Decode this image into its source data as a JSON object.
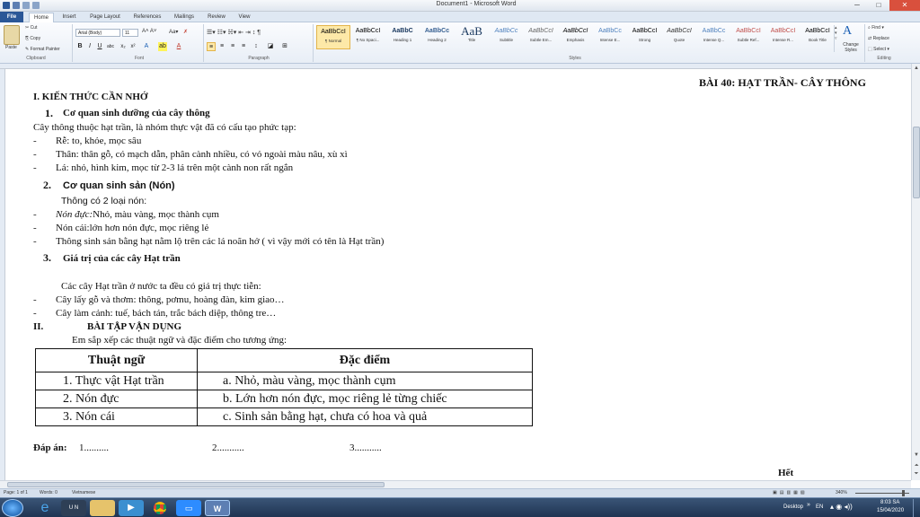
{
  "window": {
    "title": "Document1 - Microsoft Word"
  },
  "tabs": [
    {
      "label": "File"
    },
    {
      "label": "Home"
    },
    {
      "label": "Insert"
    },
    {
      "label": "Page Layout"
    },
    {
      "label": "References"
    },
    {
      "label": "Mailings"
    },
    {
      "label": "Review"
    },
    {
      "label": "View"
    }
  ],
  "ribbon": {
    "clipboard": {
      "paste": "Paste",
      "cut": "Cut",
      "copy": "Copy",
      "format_painter": "Format Painter",
      "label": "Clipboard"
    },
    "font": {
      "name": "Arial (Body)",
      "size": "11",
      "label": "Font"
    },
    "paragraph": {
      "label": "Paragraph"
    },
    "styles": {
      "label": "Styles",
      "items": [
        {
          "sample": "AaBbCcI",
          "name": "¶ Normal"
        },
        {
          "sample": "AaBbCcI",
          "name": "¶ No Spaci..."
        },
        {
          "sample": "AaBbC",
          "name": "Heading 1"
        },
        {
          "sample": "AaBbCc",
          "name": "Heading 2"
        },
        {
          "sample": "AaB",
          "name": "Title"
        },
        {
          "sample": "AaBbCc",
          "name": "Subtitle"
        },
        {
          "sample": "AaBbCcI",
          "name": "Subtle Em..."
        },
        {
          "sample": "AaBbCcI",
          "name": "Emphasis"
        },
        {
          "sample": "AaBbCc",
          "name": "Intense E..."
        },
        {
          "sample": "AaBbCcI",
          "name": "Strong"
        },
        {
          "sample": "AaBbCcI",
          "name": "Quote"
        },
        {
          "sample": "AaBbCc",
          "name": "Intense Q..."
        },
        {
          "sample": "AaBbCcI",
          "name": "Subtle Ref..."
        },
        {
          "sample": "AaBbCcI",
          "name": "Intense R..."
        },
        {
          "sample": "AaBbCcI",
          "name": "Book Title"
        }
      ],
      "change_styles": "Change Styles"
    },
    "editing": {
      "find": "Find",
      "replace": "Replace",
      "select": "Select",
      "label": "Editing"
    }
  },
  "document": {
    "header_title": "BÀI 40: HẠT TRẦN- CÂY THÔNG",
    "section1": "I. KIẾN THỨC CẦN NHỚ",
    "h1": {
      "num": "1.",
      "text": "Cơ quan sinh dưỡng của cây thông"
    },
    "p1": "Cây thông thuộc hạt trần, là nhóm thực vật đã có cấu tạo phức tạp:",
    "b1": [
      "Rễ:  to, khỏe, mọc sâu",
      "Thân: thân gỗ, có mạch dẫn, phân cành nhiều, có vỏ ngoài màu nâu, xù xì",
      "Lá: nhỏ, hình kim, mọc từ 2-3 lá trên một cành non rất ngắn"
    ],
    "h2": {
      "num": "2.",
      "text": "Cơ quan sinh sản (Nón)"
    },
    "p2": "Thông có 2 loại nón:",
    "b2_1_italic": "Nón đực:",
    "b2_1_rest": "Nhỏ, màu vàng, mọc thành cụm",
    "b2_2": "Nón cái:lớn hơn nón đực, mọc riêng lẻ",
    "b2_3": "Thông sinh sản bằng hạt nằm lộ trên các lá noãn hở ( vì vậy mới có tên là Hạt trần)",
    "h3": {
      "num": "3.",
      "text": "Giá trị của các cây Hạt trần"
    },
    "p3": "Các cây Hạt trần ở nước ta đều có giá trị thực tiễn:",
    "b3": [
      "Cây lấy gỗ và thơm: thông, pơmu, hoàng đàn, kim giao…",
      "Cây làm cảnh: tuế, bách tán, trắc bách diệp, thông tre…"
    ],
    "section2_num": "II.",
    "section2": "BÀI TẬP VẬN DỤNG",
    "p4": "Em sắp xếp các thuật ngữ và đặc điểm cho tương ứng:",
    "table": {
      "headers": [
        "Thuật ngữ",
        "Đặc điểm"
      ],
      "rows": [
        [
          "1.  Thực vật Hạt trần",
          "a.  Nhỏ, màu vàng, mọc thành cụm"
        ],
        [
          "2.  Nón đực",
          "b.  Lớn hơn nón đực, mọc riêng lẻ từng chiếc"
        ],
        [
          "3.  Nón cái",
          "c.  Sinh sản bằng hạt, chưa có hoa và quả"
        ]
      ]
    },
    "answer_label": "Đáp án:",
    "answer_1": "1..........",
    "answer_2": "2...........",
    "answer_3": "3...........",
    "end": "Hết"
  },
  "statusbar": {
    "page": "Page: 1 of 1",
    "words": "Words: 0",
    "language": "Vietnamese",
    "zoom": "340%"
  },
  "taskbar": {
    "desktop": "Desktop",
    "lang": "EN",
    "time": "8:03 SA",
    "date": "15/04/2020"
  }
}
